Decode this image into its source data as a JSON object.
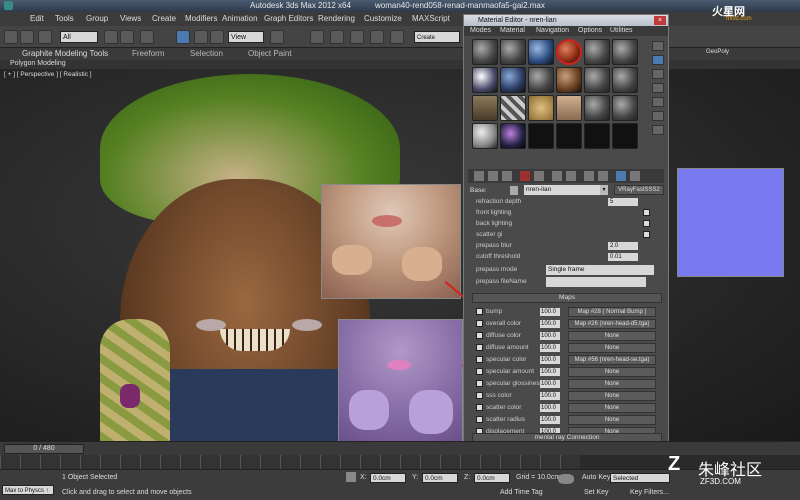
{
  "title_bar": {
    "app": "Autodesk 3ds Max  2012 x64",
    "file": "woman40-rend058-renad-manmaofa5-gai2.max"
  },
  "menu": [
    "Edit",
    "Tools",
    "Group",
    "Views",
    "Create",
    "Modifiers",
    "Animation",
    "Graph Editors",
    "Rendering",
    "Customize",
    "MAXScript"
  ],
  "toolbar": {
    "filter": "All",
    "view": "View",
    "create_selection": "Create Selection"
  },
  "ribbon": {
    "tabs": [
      "Graphite Modeling Tools",
      "Freeform",
      "Selection",
      "Object Paint"
    ],
    "sub": "Polygon Modeling",
    "geopoly": "GeoPoly"
  },
  "viewport": {
    "label": "[ + ] [ Perspective ] [ Realistic ]"
  },
  "material_editor": {
    "title": "Material Editor - nren-lian",
    "menu": [
      "Modes",
      "Material",
      "Navigation",
      "Options",
      "Utilities"
    ],
    "base_label": "Base:",
    "material_name": "nren-lian",
    "material_type": "VRayFastSSS2",
    "params": [
      {
        "label": "refraction depth",
        "value": "5"
      },
      {
        "label": "front lighting",
        "value": ""
      },
      {
        "label": "back lighting",
        "value": ""
      },
      {
        "label": "scatter gi",
        "value": ""
      },
      {
        "label": "prepass blur",
        "value": "2.0"
      },
      {
        "label": "cutoff threshold",
        "value": "0.01"
      }
    ],
    "prepass_mode_label": "prepass mode",
    "prepass_mode_value": "Single frame",
    "prepass_filename_label": "prepass fileName",
    "maps_header": "Maps",
    "maps": [
      {
        "label": "bump",
        "amount": "100.0",
        "map": "Map #28  ( Normal Bump )"
      },
      {
        "label": "overall color",
        "amount": "100.0",
        "map": "Map #26 (nren-head-d5.tga)"
      },
      {
        "label": "diffuse color",
        "amount": "100.0",
        "map": "None"
      },
      {
        "label": "diffuse amount",
        "amount": "100.0",
        "map": "None"
      },
      {
        "label": "specular color",
        "amount": "100.0",
        "map": "Map #56 (nren-head-se.tga)"
      },
      {
        "label": "specular amount",
        "amount": "100.0",
        "map": "None"
      },
      {
        "label": "specular glossiness",
        "amount": "100.0",
        "map": "None"
      },
      {
        "label": "sss color",
        "amount": "100.0",
        "map": "None"
      },
      {
        "label": "scatter color",
        "amount": "100.0",
        "map": "None"
      },
      {
        "label": "scatter radius",
        "amount": "100.0",
        "map": "None"
      },
      {
        "label": "displacement",
        "amount": "100.0",
        "map": "None"
      }
    ],
    "mental_ray": "mental ray Connection"
  },
  "timeline": {
    "frame": "0 / 480"
  },
  "status": {
    "objects_selected": "1 Object Selected",
    "hint": "Click and drag to select and move objects",
    "x": "0.0cm",
    "y": "0.0cm",
    "z": "0.0cm",
    "grid": "Grid = 10.0cm",
    "auto_key": "Auto Key",
    "selected": "Selected",
    "set_key": "Set Key",
    "key_filters": "Key Filters...",
    "add_time_tag": "Add Time Tag",
    "maxscript_mini": "Max to Physcs ↑"
  },
  "watermarks": {
    "top": "火星网",
    "top_sub": "hxsd.com",
    "bottom": "朱峰社区",
    "bottom_sub": "ZF3D.COM"
  },
  "colors": {
    "accent_red": "#d02020",
    "normal_map": "#7a7af0"
  }
}
